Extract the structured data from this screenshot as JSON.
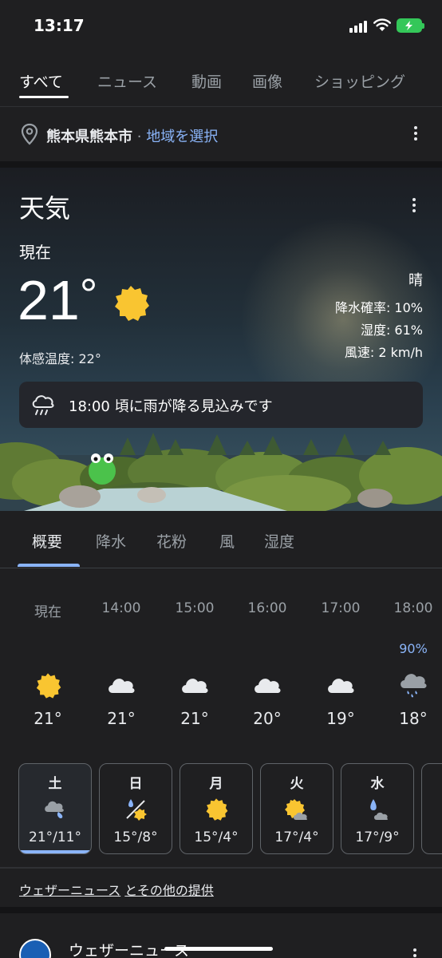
{
  "status_bar": {
    "time": "13:17"
  },
  "tabs": [
    "すべて",
    "ニュース",
    "動画",
    "画像",
    "ショッピング"
  ],
  "location": {
    "city": "熊本県熊本市",
    "separator": "·",
    "link": "地域を選択"
  },
  "weather": {
    "title": "天気",
    "now_label": "現在",
    "temperature": "21",
    "unit": "°",
    "feels_like": "体感温度: 22°",
    "condition": "晴",
    "precip": "降水確率: 10%",
    "humidity": "湿度: 61%",
    "wind": "風速: 2 km/h",
    "alert": "18:00 頃に雨が降る見込みです"
  },
  "subtabs": [
    "概要",
    "降水",
    "花粉",
    "風",
    "湿度"
  ],
  "hourly": [
    {
      "time": "現在",
      "icon": "sun-icon",
      "temp": "21°",
      "prob": ""
    },
    {
      "time": "14:00",
      "icon": "cloud-icon",
      "temp": "21°",
      "prob": ""
    },
    {
      "time": "15:00",
      "icon": "cloud-icon",
      "temp": "21°",
      "prob": ""
    },
    {
      "time": "16:00",
      "icon": "cloud-icon",
      "temp": "20°",
      "prob": ""
    },
    {
      "time": "17:00",
      "icon": "cloud-icon",
      "temp": "19°",
      "prob": ""
    },
    {
      "time": "18:00",
      "icon": "rain-cloud-icon",
      "temp": "18°",
      "prob": "90%"
    }
  ],
  "daily": [
    {
      "day": "土",
      "icon": "cloud-rain-icon",
      "temp": "21°/11°"
    },
    {
      "day": "日",
      "icon": "rain-sun-icon",
      "temp": "15°/8°"
    },
    {
      "day": "月",
      "icon": "sun-icon",
      "temp": "15°/4°"
    },
    {
      "day": "火",
      "icon": "sun-cloud-icon",
      "temp": "17°/4°"
    },
    {
      "day": "水",
      "icon": "rain-cloud-icon",
      "temp": "17°/9°"
    }
  ],
  "provider": {
    "source": "ウェザーニュース",
    "suffix": "とその他の提供"
  },
  "result": {
    "name": "ウェザーニュース"
  },
  "colors": {
    "background": "#1f1f21",
    "accent": "#8ab4f8",
    "sun": "#f9c531"
  }
}
